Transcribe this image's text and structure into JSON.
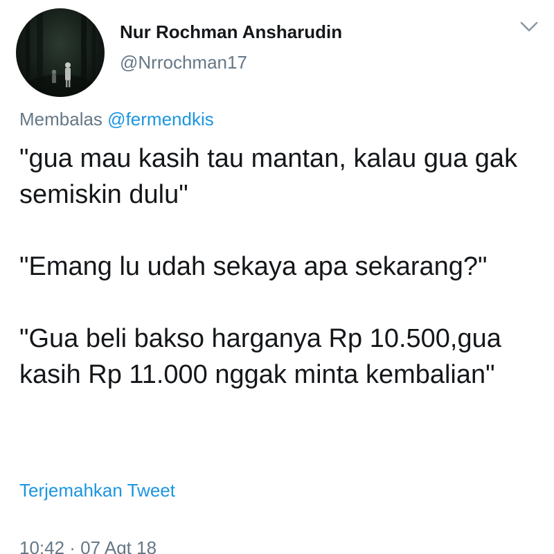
{
  "author": {
    "display_name": "Nur Rochman Ansharudin",
    "handle": "@Nrrochman17",
    "avatar_icon": "profile-photo"
  },
  "menu_icon": "chevron-down-icon",
  "reply": {
    "prefix": "Membalas",
    "mention": "@fermendkis"
  },
  "tweet": {
    "paragraphs": [
      "\"gua mau kasih tau mantan, kalau gua gak semiskin dulu\"",
      "\"Emang lu udah sekaya apa sekarang?\"",
      "\"Gua beli bakso harganya Rp 10.500,gua kasih Rp 11.000 nggak minta kembalian\""
    ]
  },
  "translate_label": "Terjemahkan Tweet",
  "timestamp": "10:42 · 07 Agt 18",
  "colors": {
    "text": "#14171a",
    "secondary": "#657786",
    "link": "#1b95e0",
    "background": "#ffffff"
  }
}
